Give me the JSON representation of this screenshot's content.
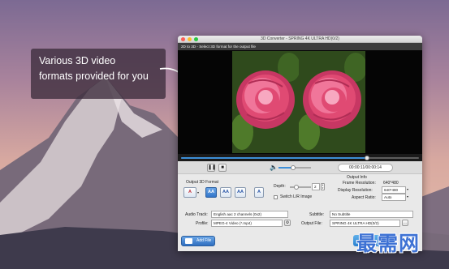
{
  "callout": {
    "line1": "Various 3D video",
    "line2": "formats provided for you"
  },
  "window": {
    "title": "3D Converter - SPRING 4K ULTRA HD(0/2)",
    "subtitle": "2D to 3D - Select 3D format for the output file"
  },
  "player": {
    "time": "00:00:11/00:00:14",
    "progress": 0.78,
    "volume": 0.45,
    "play_icon": "pause-icon",
    "stop_icon": "stop-icon"
  },
  "settings": {
    "output_3d_format_label": "Output 3D Format",
    "formats": [
      "A",
      "AA",
      "AA",
      "AA",
      "A"
    ],
    "selected_format": 1,
    "depth_label": "Depth:",
    "depth_value": "2",
    "depth_level": 0.3,
    "switch_lr_label": "Switch L/R Image",
    "switch_lr_checked": false,
    "output_info_label": "Output Info",
    "frame_resolution_label": "Frame Resolution:",
    "frame_resolution_value": "640*480",
    "display_resolution_label": "Display Resolution:",
    "display_resolution_value": "640*480",
    "aspect_ratio_label": "Aspect Ratio:",
    "aspect_ratio_value": "Auto",
    "audio_track_label": "Audio Track:",
    "audio_track_value": "English aac 2 channels (0x2)",
    "subtitle_label": "Subtitle:",
    "subtitle_value": "No Subtitle",
    "profile_label": "Profile:",
    "profile_value": "MPEG-4 Video (*.mp4)",
    "output_file_label": "Output File:",
    "output_file_value": "SPRING 4K ULTRA HD(0/2)"
  },
  "buttons": {
    "add_file": "Add File"
  },
  "watermark": "最需网",
  "colors": {
    "accent": "#3d8fd8",
    "flower": "#e04a73",
    "background": "#8a6e86"
  }
}
